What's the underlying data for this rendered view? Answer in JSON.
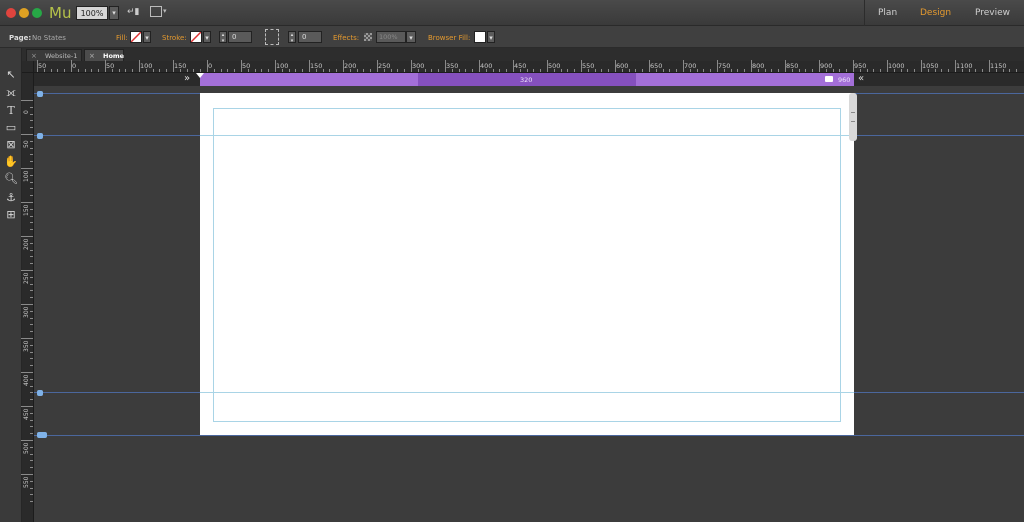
{
  "app": {
    "logo": "Mu",
    "zoom": "100%",
    "modes": [
      "Plan",
      "Design",
      "Preview"
    ],
    "active_mode": "Design",
    "accent_color": "#e59a2f"
  },
  "controls": {
    "page_label": "Page:",
    "page_state": "No States",
    "fill_label": "Fill:",
    "stroke_label": "Stroke:",
    "stroke_value": "0",
    "corner_value": "0",
    "effects_label": "Effects:",
    "opacity_value": "100%",
    "browser_fill_label": "Browser Fill:"
  },
  "tabs": [
    {
      "label": "Website-1",
      "active": false
    },
    {
      "label": "Home",
      "active": true
    }
  ],
  "ruler": {
    "h_labels": [
      "50",
      "0",
      "50",
      "100",
      "150",
      "0",
      "50",
      "100",
      "150",
      "200",
      "250",
      "300",
      "350",
      "400",
      "450",
      "500",
      "550",
      "600",
      "650",
      "700",
      "750",
      "800",
      "850",
      "900",
      "950",
      "1000",
      "1050",
      "1100",
      "1150"
    ],
    "v_labels": [
      "0",
      "50",
      "100",
      "150",
      "200",
      "250",
      "300",
      "350",
      "400",
      "450",
      "500",
      "550"
    ]
  },
  "breakpoints": {
    "mid_value": "320",
    "right_value": "960",
    "left_arrow": "»",
    "right_arrow": "«"
  },
  "tools": [
    "selection-tool",
    "crop-tool",
    "text-tool",
    "rectangle-tool",
    "image-frame-tool",
    "hand-tool",
    "zoom-tool",
    "anchor-tool",
    "grid-tool"
  ]
}
